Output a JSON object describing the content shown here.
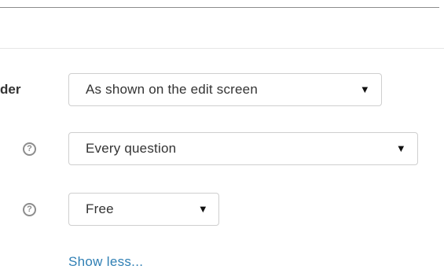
{
  "settings": {
    "rows": [
      {
        "label": "der",
        "select_value": "As shown on the edit screen"
      },
      {
        "help_icon": "question-circle-icon",
        "help_glyph": "?",
        "select_value": "Every question"
      },
      {
        "help_icon": "question-circle-icon",
        "help_glyph": "?",
        "select_value": "Free"
      }
    ],
    "dropdown_arrow": "▼",
    "show_less_label": "Show less..."
  },
  "colors": {
    "link": "#2f7fb4",
    "select_border": "#cfcfcf",
    "help_icon": "#8d8d8d",
    "top_rule": "#8c8c8c",
    "section_rule": "#e6e6e6"
  }
}
